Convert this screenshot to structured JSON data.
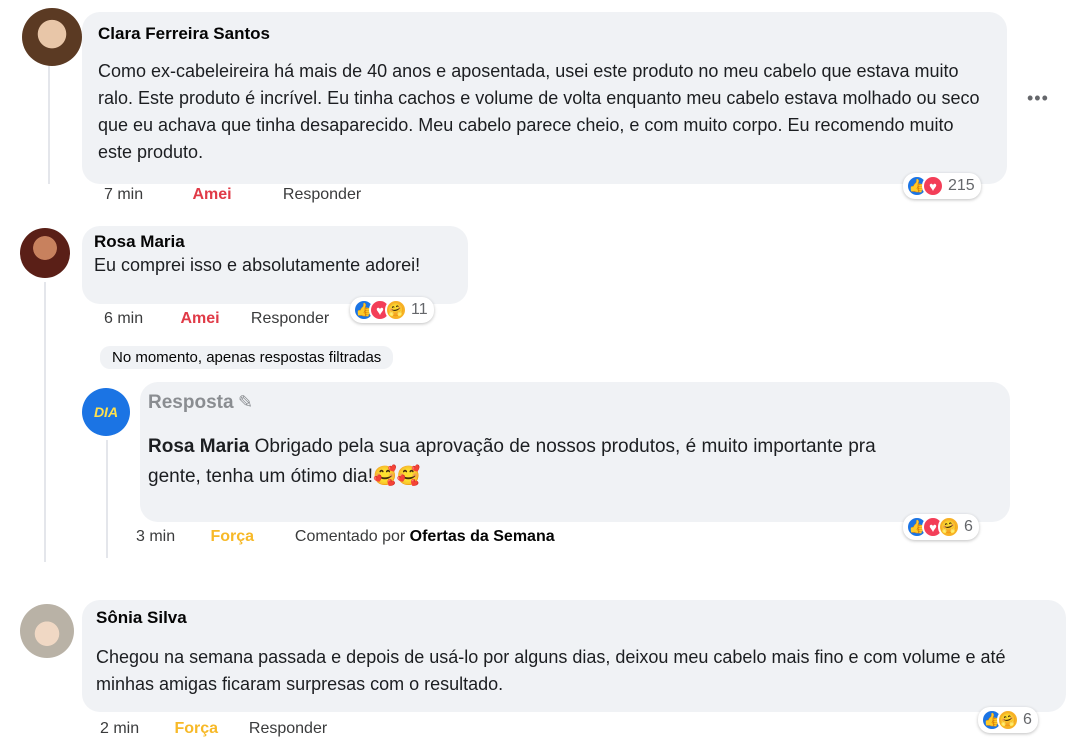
{
  "comments": [
    {
      "author": "Clara Ferreira Santos",
      "text": "Como ex-cabeleireira há mais de 40 anos e aposentada, usei este produto no meu cabelo que estava muito ralo. Este produto é incrível. Eu tinha cachos e  volume de volta enquanto meu cabelo estava molhado ou  seco que eu achava que tinha desaparecido. Meu cabelo parece cheio, e com muito corpo. Eu recomendo muito este produto.",
      "time": "7 min",
      "reaction_label": "Amei",
      "reply_label": "Responder",
      "reaction_count": "215",
      "more": "•••"
    },
    {
      "author": "Rosa Maria",
      "text": "Eu comprei isso e absolutamente adorei!",
      "time": "6 min",
      "reaction_label": "Amei",
      "reply_label": "Responder",
      "reaction_count": "11"
    },
    {
      "author": "Sônia Silva",
      "text": "Chegou na semana passada e depois de usá-lo por alguns dias, deixou meu cabelo mais fino e com volume e até minhas amigas ficaram surpresas com o resultado.",
      "time": "2 min",
      "reaction_label": "Força",
      "reply_label": "Responder",
      "reaction_count": "6"
    }
  ],
  "filter_notice": "No momento, apenas respostas filtradas",
  "page_reply": {
    "header": "Resposta",
    "mention": "Rosa Maria",
    "text": "Obrigado pela sua aprovação de nossos produtos, é muito importante pra gente, tenha um ótimo dia!🥰🥰",
    "time": "3 min",
    "reaction_label": "Força",
    "commented_by_prefix": "Comentado por",
    "commented_by": "Ofertas da Semana",
    "reaction_count": "6",
    "avatar_text": "DIA"
  },
  "colors": {
    "love": "#e03a47",
    "care": "#f7b928",
    "like": "#1b74e4",
    "bubble": "#f0f2f5"
  }
}
